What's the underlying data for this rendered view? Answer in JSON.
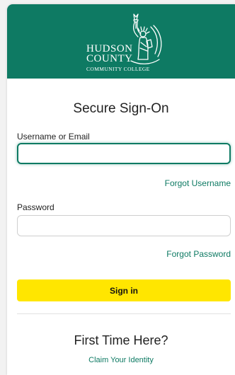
{
  "brand": {
    "line1": "HUDSON",
    "line2": "COUNTY",
    "line3": "COMMUNITY COLLEGE",
    "header_color": "#0e7a63",
    "accent_color": "#0e7a63",
    "button_color": "#ffe600"
  },
  "form": {
    "title": "Secure Sign-On",
    "username_label": "Username or Email",
    "username_value": "",
    "forgot_username": "Forgot Username",
    "password_label": "Password",
    "password_value": "",
    "forgot_password": "Forgot Password",
    "signin_label": "Sign in"
  },
  "footer": {
    "heading": "First Time Here?",
    "claim_link": "Claim Your Identity"
  },
  "icons": {
    "logo": "statue-of-liberty-icon"
  }
}
